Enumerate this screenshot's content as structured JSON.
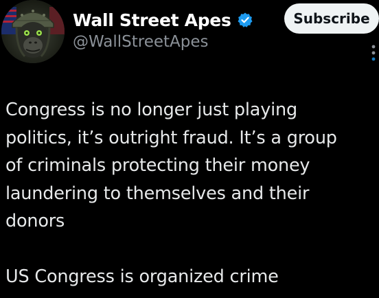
{
  "account": {
    "display_name": "Wall Street Apes",
    "handle": "@WallStreetApes",
    "verified": true,
    "avatar_icon": "gorilla-soldier-avatar-icon",
    "verified_icon": "verified-badge-icon"
  },
  "actions": {
    "subscribe_label": "Subscribe",
    "more_icon": "more-vertical-icon"
  },
  "tweet": {
    "paragraph_1": "Congress is no longer just playing\npolitics, it’s outright fraud. It’s a group\nof criminals protecting their money\nlaundering to themselves and their\ndonors",
    "paragraph_2": "US Congress is organized crime"
  },
  "colors": {
    "background": "#000000",
    "text_primary": "#e7e9ea",
    "text_secondary": "#8b9198",
    "verified_blue": "#1d9bf0",
    "button_bg": "#eff3f4",
    "button_text": "#0f1419"
  }
}
